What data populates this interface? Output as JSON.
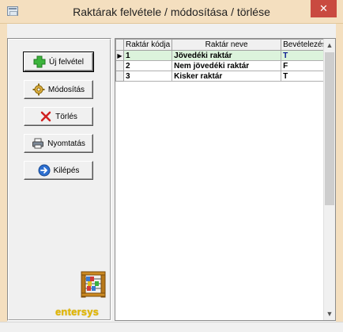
{
  "window": {
    "title": "Raktárak felvétele / módosítása / törlése",
    "close_glyph": "✕"
  },
  "buttons": {
    "new": {
      "label": "Új felvétel",
      "icon": "green-plus-icon"
    },
    "modify": {
      "label": "Módosítás",
      "icon": "gear-icon"
    },
    "delete": {
      "label": "Törlés",
      "icon": "red-x-icon"
    },
    "print": {
      "label": "Nyomtatás",
      "icon": "printer-icon"
    },
    "exit": {
      "label": "Kilépés",
      "icon": "blue-arrow-icon"
    }
  },
  "logo": {
    "text": "entersys",
    "color": "#e3b800"
  },
  "table": {
    "columns": [
      "Raktár kódja",
      "Raktár neve",
      "Bevételezés"
    ],
    "rows": [
      {
        "code": "1",
        "name": "Jövedéki raktár",
        "intake": "T",
        "selected": true
      },
      {
        "code": "2",
        "name": "Nem jövedéki raktár",
        "intake": "F",
        "selected": false
      },
      {
        "code": "3",
        "name": "Kisker raktár",
        "intake": "T",
        "selected": false
      }
    ],
    "current_row_marker": "▶"
  },
  "colors": {
    "selected_row": "#dcf3dc",
    "title_bar": "#f4dfbf",
    "close_button": "#c94a40"
  }
}
